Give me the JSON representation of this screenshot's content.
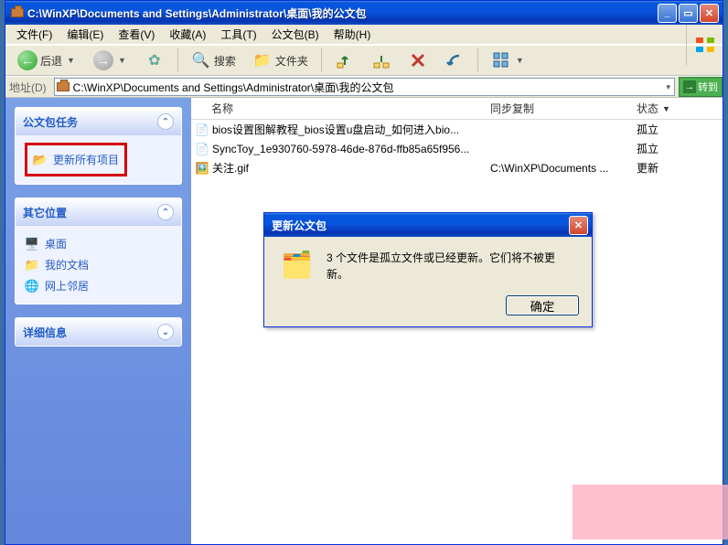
{
  "window": {
    "title": "C:\\WinXP\\Documents and Settings\\Administrator\\桌面\\我的公文包"
  },
  "menu": {
    "file": "文件(F)",
    "edit": "编辑(E)",
    "view": "查看(V)",
    "fav": "收藏(A)",
    "tools": "工具(T)",
    "briefcase": "公文包(B)",
    "help": "帮助(H)"
  },
  "toolbar": {
    "back": "后退",
    "search": "搜索",
    "folders": "文件夹"
  },
  "address": {
    "label": "地址(D)",
    "path": "C:\\WinXP\\Documents and Settings\\Administrator\\桌面\\我的公文包",
    "go": "转到"
  },
  "sidebar": {
    "tasks_hdr": "公文包任务",
    "task_updateall": "更新所有项目",
    "places_hdr": "其它位置",
    "places": [
      {
        "label": "桌面",
        "icon": "🖥️"
      },
      {
        "label": "我的文档",
        "icon": "📁"
      },
      {
        "label": "网上邻居",
        "icon": "🌐"
      }
    ],
    "details_hdr": "详细信息"
  },
  "columns": {
    "name": "名称",
    "sync": "同步复制",
    "status": "状态"
  },
  "files": [
    {
      "icon": "📄",
      "name": "bios设置图解教程_bios设置u盘启动_如何进入bio...",
      "sync": "",
      "status": "孤立"
    },
    {
      "icon": "📄",
      "name": "SyncToy_1e930760-5978-46de-876d-ffb85a65f956...",
      "sync": "",
      "status": "孤立"
    },
    {
      "icon": "🖼️",
      "name": "关注.gif",
      "sync": "C:\\WinXP\\Documents ...",
      "status": "更新"
    }
  ],
  "dialog": {
    "title": "更新公文包",
    "message": "3 个文件是孤立文件或已经更新。它们将不被更新。",
    "ok": "确定"
  }
}
